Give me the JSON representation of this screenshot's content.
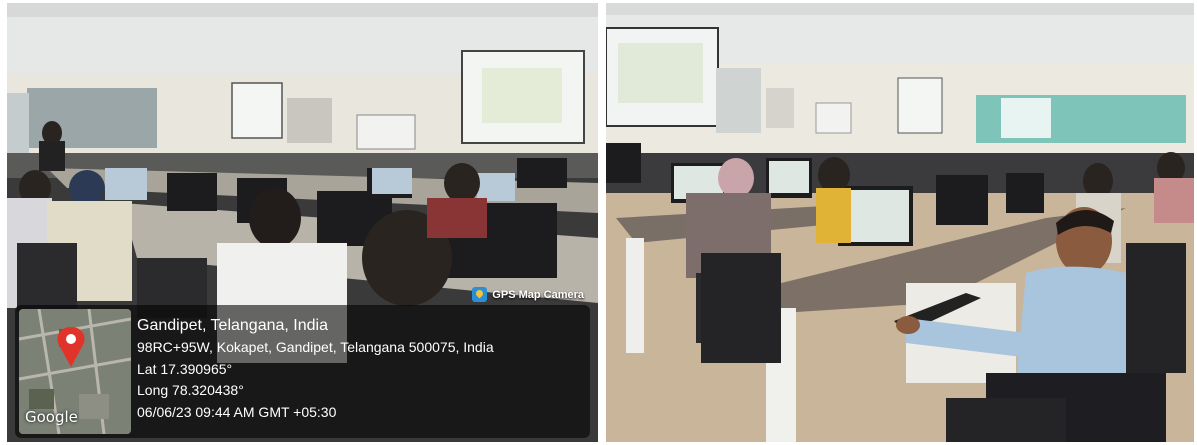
{
  "gps_overlay": {
    "badge_label": "GPS Map Camera",
    "location_title": "Gandipet, Telangana, India",
    "address": "98RC+95W, Kokapet, Gandipet, Telangana 500075, India",
    "latitude": "Lat 17.390965°",
    "longitude": "Long 78.320438°",
    "timestamp": "06/06/23 09:44 AM GMT +05:30",
    "map_watermark": "Google",
    "pin_icon": "map-pin-icon",
    "app_icon": "gps-map-camera-icon"
  }
}
